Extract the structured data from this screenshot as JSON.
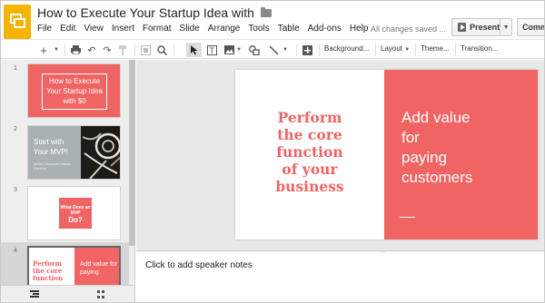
{
  "app": {
    "title": "How to Execute Your Startup Idea with",
    "save_status": "All changes saved ...",
    "present_label": "Present",
    "comments_label": "Comments"
  },
  "menu": [
    "File",
    "Edit",
    "View",
    "Insert",
    "Format",
    "Slide",
    "Arrange",
    "Tools",
    "Table",
    "Add-ons",
    "Help"
  ],
  "toolbar": {
    "background_label": "Background...",
    "layout_label": "Layout",
    "theme_label": "Theme...",
    "transition_label": "Transition..."
  },
  "slides": [
    {
      "number": "1",
      "text": "How to Execute Your Startup Idea with $0"
    },
    {
      "number": "2",
      "title": "Start with Your MVP!",
      "subtitle": "MMM: Minimum Viable Product"
    },
    {
      "number": "3",
      "line1": "What Does an MVP",
      "line2": "Do?"
    },
    {
      "number": "4",
      "left_text": "Perform the core function",
      "right_text": "Add value for paying"
    }
  ],
  "current_slide": {
    "left_lines": [
      "Perform",
      "the core",
      "function",
      "of your",
      "business"
    ],
    "right_lines": [
      "Add value",
      "for",
      "paying",
      "customers"
    ]
  },
  "notes_placeholder": "Click to add speaker notes",
  "colors": {
    "accent": "#f06464",
    "logo": "#f4b400"
  }
}
